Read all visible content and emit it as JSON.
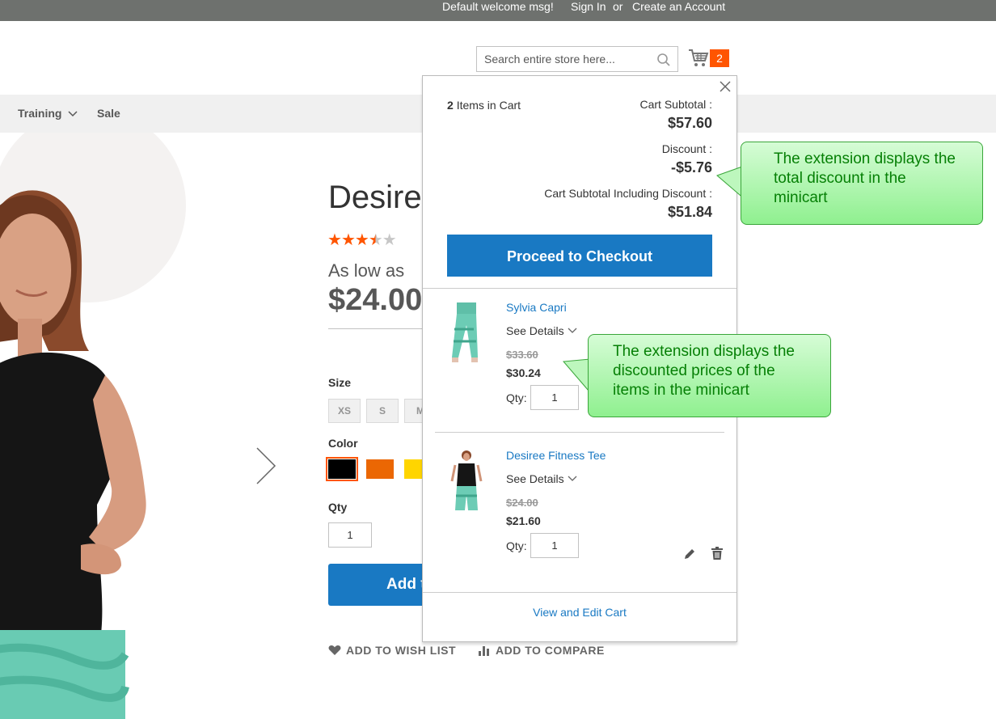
{
  "top_panel": {
    "welcome": "Default welcome msg!",
    "sign_in": "Sign In",
    "or": "or",
    "create_account": "Create an Account"
  },
  "header": {
    "search_placeholder": "Search entire store here...",
    "cart_count": "2"
  },
  "nav": {
    "items": [
      {
        "label": "Training",
        "has_dropdown": true
      },
      {
        "label": "Sale",
        "has_dropdown": false
      }
    ]
  },
  "product": {
    "title": "Desire",
    "rating_stars_filled": 3.5,
    "rating_stars_total": 5,
    "as_low_as": "As low as",
    "price": "$24.00",
    "size_label": "Size",
    "sizes": [
      "XS",
      "S",
      "M"
    ],
    "color_label": "Color",
    "colors": [
      "#000000",
      "#eb6703",
      "#ffd500"
    ],
    "qty_label": "Qty",
    "qty_value": "1",
    "add_to_cart_label": "Add t",
    "add_to_wishlist": "ADD TO WISH LIST",
    "add_to_compare": "ADD TO COMPARE"
  },
  "minicart": {
    "items_count": "2",
    "items_in_cart": "Items in Cart",
    "subtotal_label": "Cart Subtotal :",
    "subtotal_value": "$57.60",
    "discount_label": "Discount :",
    "discount_value": "-$5.76",
    "subtotal_incl_label": "Cart Subtotal Including Discount :",
    "subtotal_incl_value": "$51.84",
    "checkout_label": "Proceed to Checkout",
    "items": [
      {
        "name": "Sylvia Capri",
        "see_details": "See Details",
        "old_price": "$33.60",
        "new_price": "$30.24",
        "qty_label": "Qty:",
        "qty": "1"
      },
      {
        "name": "Desiree Fitness Tee",
        "see_details": "See Details",
        "old_price": "$24.00",
        "new_price": "$21.60",
        "qty_label": "Qty:",
        "qty": "1"
      }
    ],
    "view_edit": "View and Edit Cart"
  },
  "callouts": {
    "discount_note": "The extension displays the total discount in the minicart",
    "prices_note": "The extension displays the discounted prices of the items in the minicart"
  },
  "colors": {
    "accent": "#1979c3",
    "cart_badge": "#ff5501",
    "callout_text": "#068006"
  }
}
